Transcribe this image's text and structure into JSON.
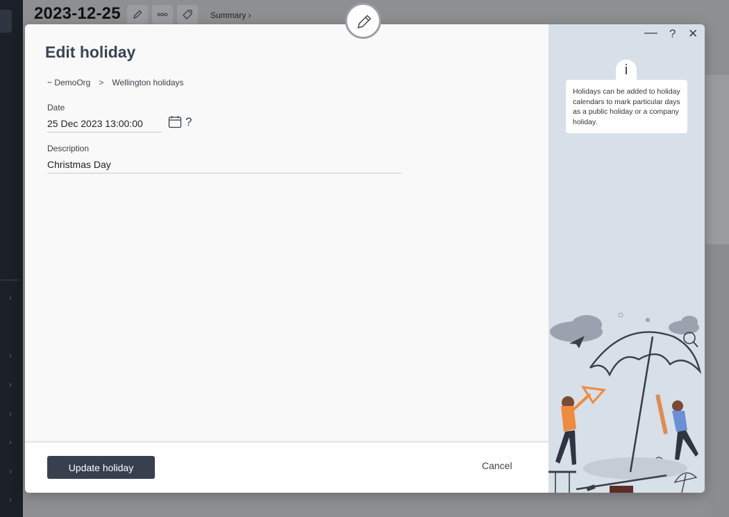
{
  "background": {
    "page_title": "2023-12-25",
    "summary_link": "Summary ›"
  },
  "modal": {
    "title": "Edit holiday",
    "breadcrumb": {
      "org": "~ DemoOrg",
      "separator": ">",
      "calendar": "Wellington holidays"
    },
    "fields": {
      "date": {
        "label": "Date",
        "value": "25 Dec 2023 13:00:00",
        "help": "?"
      },
      "description": {
        "label": "Description",
        "value": "Christmas Day"
      }
    },
    "buttons": {
      "update": "Update holiday",
      "cancel": "Cancel"
    },
    "window_controls": {
      "minimize": "—",
      "help": "?",
      "close": "✕"
    },
    "info": {
      "marker": "i",
      "text": "Holidays can be added to holiday calendars to mark particular days as a public holiday or a company holiday."
    }
  },
  "icons": [
    "pencil-icon",
    "more-icon",
    "tag-icon",
    "calendar-icon",
    "info-icon"
  ],
  "colors": {
    "primary_button": "#38404f",
    "side_panel": "#d7dfe8",
    "title_text": "#3c4454"
  }
}
